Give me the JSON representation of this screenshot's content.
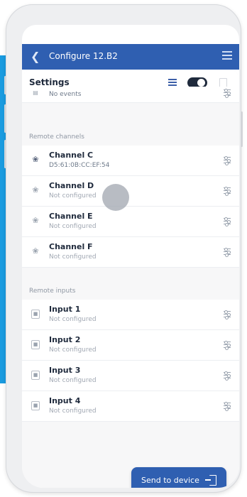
{
  "header": {
    "title": "Configure 12.B2"
  },
  "settings": {
    "label": "Settings"
  },
  "events": {
    "sub": "No events"
  },
  "sections": {
    "remote_channels": "Remote channels",
    "remote_inputs": "Remote inputs"
  },
  "channels": [
    {
      "name": "Channel C",
      "sub": "D5:61:0B:CC:EF:54"
    },
    {
      "name": "Channel D",
      "sub": "Not configured"
    },
    {
      "name": "Channel E",
      "sub": "Not configured"
    },
    {
      "name": "Channel F",
      "sub": "Not configured"
    }
  ],
  "inputs": [
    {
      "name": "Input 1",
      "sub": "Not configured"
    },
    {
      "name": "Input 2",
      "sub": "Not configured"
    },
    {
      "name": "Input 3",
      "sub": "Not configured"
    },
    {
      "name": "Input 4",
      "sub": "Not configured"
    }
  ],
  "send_button": {
    "label": "Send to device"
  },
  "icons": {
    "back": "chevron-left-icon",
    "menu": "menu-icon",
    "list": "list-icon",
    "toggle": "toggle-switch",
    "channel": "remote-channel-icon",
    "input": "input-icon",
    "adjust": "sliders-icon",
    "send": "send-icon"
  },
  "toggle": {
    "on": true
  },
  "colors": {
    "primary": "#2f5fb1",
    "accent_blue": "#1a9be0",
    "dark": "#1f2a3c"
  }
}
